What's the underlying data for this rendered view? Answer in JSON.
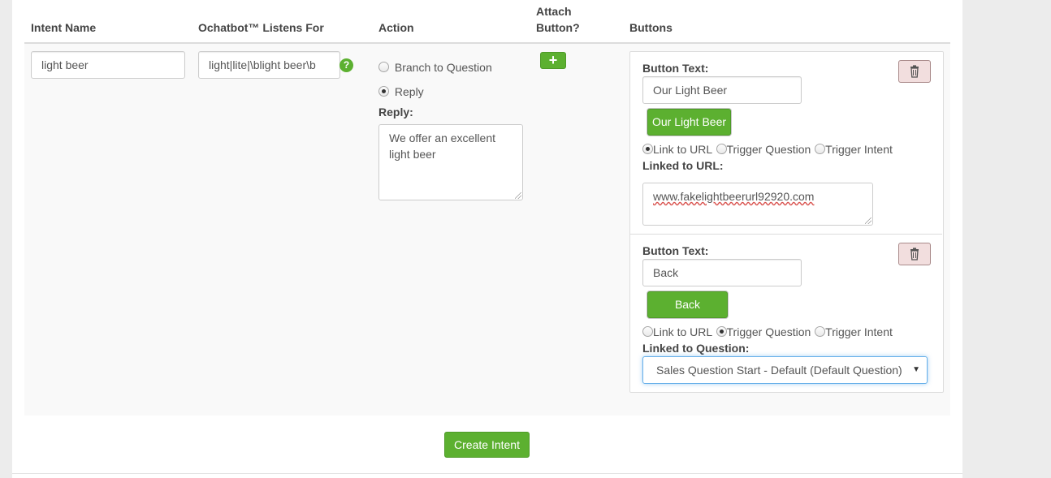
{
  "table": {
    "headers": {
      "intent_name": "Intent Name",
      "listens_for": "Ochatbot™ Listens For",
      "action": "Action",
      "attach_line1": "Attach",
      "attach_line2": "Button?",
      "buttons": "Buttons"
    }
  },
  "row": {
    "intent_name_value": "light beer",
    "listens_for_value": "light|lite|\\blight beer\\b",
    "help_symbol": "?",
    "action": {
      "branch_label": "Branch to Question",
      "reply_label": "Reply",
      "selected": "Reply",
      "reply_heading": "Reply:",
      "reply_text_line1": "We offer an excellent",
      "reply_text_line2": "light beer"
    },
    "attach_button_symbol": "+"
  },
  "buttons": [
    {
      "heading": "Button Text:",
      "text_value": "Our Light Beer",
      "preview_label": "Our Light Beer",
      "options": {
        "link_url": "Link to URL",
        "trigger_question": "Trigger Question",
        "trigger_intent": "Trigger Intent"
      },
      "selected_option": "Link to URL",
      "linked_heading": "Linked to URL:",
      "linked_value": "www.fakelightbeerurl92920.com"
    },
    {
      "heading": "Button Text:",
      "text_value": "Back",
      "preview_label": "Back",
      "options": {
        "link_url": "Link to URL",
        "trigger_question": "Trigger Question",
        "trigger_intent": "Trigger Intent"
      },
      "selected_option": "Trigger Question",
      "linked_heading": "Linked to Question:",
      "linked_value": "Sales Question Start - Default (Default Question)"
    }
  ],
  "footer": {
    "create_label": "Create Intent"
  },
  "colors": {
    "accent_green": "#5cb030",
    "danger_bg": "#f2dede",
    "focus_blue": "#66afe9"
  },
  "icons": {
    "help": "question-circle-icon",
    "add": "plus-icon",
    "delete": "trash-icon",
    "select": "caret-down-icon"
  }
}
